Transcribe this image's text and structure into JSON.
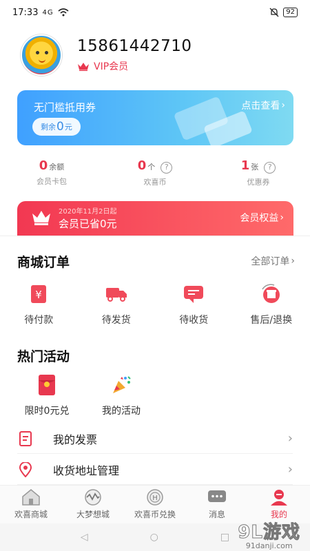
{
  "status_bar": {
    "time": "17:33",
    "signal": "4G",
    "battery": "92"
  },
  "profile": {
    "phone": "15861442710",
    "vip_label": "VIP会员"
  },
  "coupon_banner": {
    "title": "无门槛抵用券",
    "remain_prefix": "剩余",
    "remain_value": "0",
    "remain_unit": "元",
    "link": "点击查看"
  },
  "stats": [
    {
      "value": "0",
      "unit": "余额",
      "label": "会员卡包",
      "has_help": false
    },
    {
      "value": "0",
      "unit": "个",
      "label": "欢喜币",
      "has_help": true
    },
    {
      "value": "1",
      "unit": "张",
      "label": "优惠券",
      "has_help": true
    }
  ],
  "savings": {
    "date": "2020年11月2日起",
    "amount": "会员已省0元",
    "link": "会员权益"
  },
  "orders": {
    "title": "商城订单",
    "all_link": "全部订单",
    "items": [
      {
        "label": "待付款",
        "icon": "yuan-wallet-icon"
      },
      {
        "label": "待发货",
        "icon": "truck-icon"
      },
      {
        "label": "待收货",
        "icon": "message-icon"
      },
      {
        "label": "售后/退换",
        "icon": "return-box-icon"
      }
    ]
  },
  "activities": {
    "title": "热门活动",
    "items": [
      {
        "label": "限时0元兑",
        "icon": "red-envelope-icon"
      },
      {
        "label": "我的活动",
        "icon": "party-popper-icon"
      }
    ]
  },
  "menu": [
    {
      "label": "我的发票",
      "icon": "invoice-icon"
    },
    {
      "label": "收货地址管理",
      "icon": "location-pin-icon"
    }
  ],
  "tabs": [
    {
      "label": "欢喜商城",
      "icon": "home-icon",
      "active": false
    },
    {
      "label": "大梦想城",
      "icon": "wave-icon",
      "active": false
    },
    {
      "label": "欢喜币兑换",
      "icon": "coin-icon",
      "active": false
    },
    {
      "label": "消息",
      "icon": "chat-icon",
      "active": false
    },
    {
      "label": "我的",
      "icon": "user-icon",
      "active": true
    }
  ],
  "watermark": {
    "main": "9L游戏",
    "sub": "91danji.com"
  },
  "colors": {
    "accent": "#e8384f",
    "banner_blue": "#3fa0ff"
  }
}
